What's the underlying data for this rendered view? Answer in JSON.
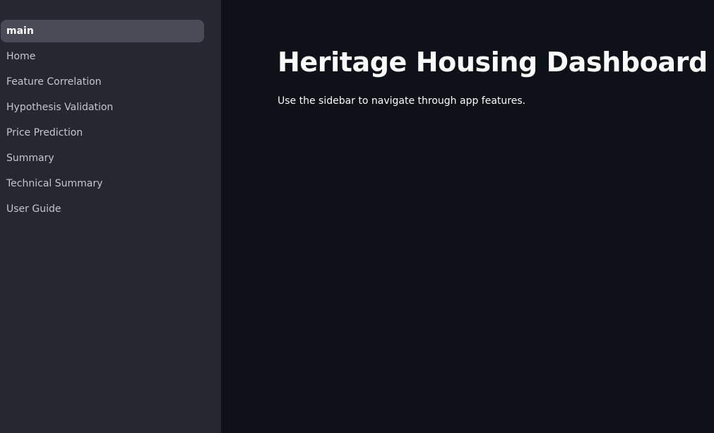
{
  "sidebar": {
    "items": [
      {
        "label": "main",
        "active": true
      },
      {
        "label": "Home"
      },
      {
        "label": "Feature Correlation"
      },
      {
        "label": "Hypothesis Validation"
      },
      {
        "label": "Price Prediction"
      },
      {
        "label": "Summary"
      },
      {
        "label": "Technical Summary"
      },
      {
        "label": "User Guide"
      }
    ]
  },
  "main": {
    "title": "Heritage Housing Dashboard",
    "subtitle": "Use the sidebar to navigate through app features."
  },
  "colors": {
    "sidebar_bg": "#262730",
    "main_bg": "#0e1117",
    "active_item_bg": "#4a4b57",
    "text_primary": "#fafafa",
    "text_secondary": "#c3c6cf"
  }
}
